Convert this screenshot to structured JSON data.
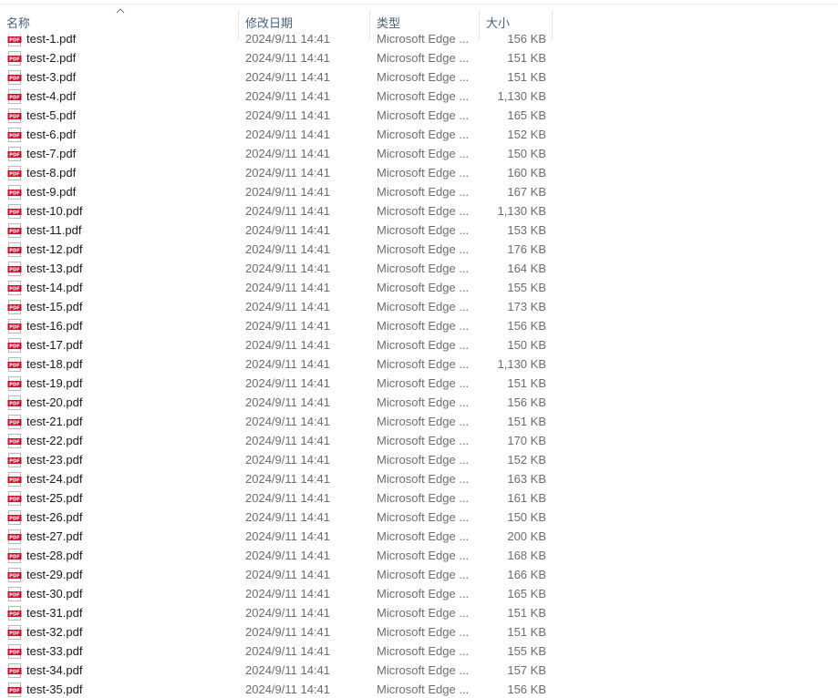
{
  "columns": {
    "name": "名称",
    "date": "修改日期",
    "type": "类型",
    "size": "大小"
  },
  "colors": {
    "header_text": "#4c607a",
    "name_text": "#1a1a1a",
    "meta_text": "#6d6d6d",
    "pdf_icon_red": "#c8102e"
  },
  "icon": "pdf-file-icon",
  "files": [
    {
      "name": "test-1.pdf",
      "date": "2024/9/11 14:41",
      "type": "Microsoft Edge ...",
      "size": "156 KB"
    },
    {
      "name": "test-2.pdf",
      "date": "2024/9/11 14:41",
      "type": "Microsoft Edge ...",
      "size": "151 KB"
    },
    {
      "name": "test-3.pdf",
      "date": "2024/9/11 14:41",
      "type": "Microsoft Edge ...",
      "size": "151 KB"
    },
    {
      "name": "test-4.pdf",
      "date": "2024/9/11 14:41",
      "type": "Microsoft Edge ...",
      "size": "1,130 KB"
    },
    {
      "name": "test-5.pdf",
      "date": "2024/9/11 14:41",
      "type": "Microsoft Edge ...",
      "size": "165 KB"
    },
    {
      "name": "test-6.pdf",
      "date": "2024/9/11 14:41",
      "type": "Microsoft Edge ...",
      "size": "152 KB"
    },
    {
      "name": "test-7.pdf",
      "date": "2024/9/11 14:41",
      "type": "Microsoft Edge ...",
      "size": "150 KB"
    },
    {
      "name": "test-8.pdf",
      "date": "2024/9/11 14:41",
      "type": "Microsoft Edge ...",
      "size": "160 KB"
    },
    {
      "name": "test-9.pdf",
      "date": "2024/9/11 14:41",
      "type": "Microsoft Edge ...",
      "size": "167 KB"
    },
    {
      "name": "test-10.pdf",
      "date": "2024/9/11 14:41",
      "type": "Microsoft Edge ...",
      "size": "1,130 KB"
    },
    {
      "name": "test-11.pdf",
      "date": "2024/9/11 14:41",
      "type": "Microsoft Edge ...",
      "size": "153 KB"
    },
    {
      "name": "test-12.pdf",
      "date": "2024/9/11 14:41",
      "type": "Microsoft Edge ...",
      "size": "176 KB"
    },
    {
      "name": "test-13.pdf",
      "date": "2024/9/11 14:41",
      "type": "Microsoft Edge ...",
      "size": "164 KB"
    },
    {
      "name": "test-14.pdf",
      "date": "2024/9/11 14:41",
      "type": "Microsoft Edge ...",
      "size": "155 KB"
    },
    {
      "name": "test-15.pdf",
      "date": "2024/9/11 14:41",
      "type": "Microsoft Edge ...",
      "size": "173 KB"
    },
    {
      "name": "test-16.pdf",
      "date": "2024/9/11 14:41",
      "type": "Microsoft Edge ...",
      "size": "156 KB"
    },
    {
      "name": "test-17.pdf",
      "date": "2024/9/11 14:41",
      "type": "Microsoft Edge ...",
      "size": "150 KB"
    },
    {
      "name": "test-18.pdf",
      "date": "2024/9/11 14:41",
      "type": "Microsoft Edge ...",
      "size": "1,130 KB"
    },
    {
      "name": "test-19.pdf",
      "date": "2024/9/11 14:41",
      "type": "Microsoft Edge ...",
      "size": "151 KB"
    },
    {
      "name": "test-20.pdf",
      "date": "2024/9/11 14:41",
      "type": "Microsoft Edge ...",
      "size": "156 KB"
    },
    {
      "name": "test-21.pdf",
      "date": "2024/9/11 14:41",
      "type": "Microsoft Edge ...",
      "size": "151 KB"
    },
    {
      "name": "test-22.pdf",
      "date": "2024/9/11 14:41",
      "type": "Microsoft Edge ...",
      "size": "170 KB"
    },
    {
      "name": "test-23.pdf",
      "date": "2024/9/11 14:41",
      "type": "Microsoft Edge ...",
      "size": "152 KB"
    },
    {
      "name": "test-24.pdf",
      "date": "2024/9/11 14:41",
      "type": "Microsoft Edge ...",
      "size": "163 KB"
    },
    {
      "name": "test-25.pdf",
      "date": "2024/9/11 14:41",
      "type": "Microsoft Edge ...",
      "size": "161 KB"
    },
    {
      "name": "test-26.pdf",
      "date": "2024/9/11 14:41",
      "type": "Microsoft Edge ...",
      "size": "150 KB"
    },
    {
      "name": "test-27.pdf",
      "date": "2024/9/11 14:41",
      "type": "Microsoft Edge ...",
      "size": "200 KB"
    },
    {
      "name": "test-28.pdf",
      "date": "2024/9/11 14:41",
      "type": "Microsoft Edge ...",
      "size": "168 KB"
    },
    {
      "name": "test-29.pdf",
      "date": "2024/9/11 14:41",
      "type": "Microsoft Edge ...",
      "size": "166 KB"
    },
    {
      "name": "test-30.pdf",
      "date": "2024/9/11 14:41",
      "type": "Microsoft Edge ...",
      "size": "165 KB"
    },
    {
      "name": "test-31.pdf",
      "date": "2024/9/11 14:41",
      "type": "Microsoft Edge ...",
      "size": "151 KB"
    },
    {
      "name": "test-32.pdf",
      "date": "2024/9/11 14:41",
      "type": "Microsoft Edge ...",
      "size": "151 KB"
    },
    {
      "name": "test-33.pdf",
      "date": "2024/9/11 14:41",
      "type": "Microsoft Edge ...",
      "size": "155 KB"
    },
    {
      "name": "test-34.pdf",
      "date": "2024/9/11 14:41",
      "type": "Microsoft Edge ...",
      "size": "157 KB"
    },
    {
      "name": "test-35.pdf",
      "date": "2024/9/11 14:41",
      "type": "Microsoft Edge ...",
      "size": "156 KB"
    }
  ]
}
